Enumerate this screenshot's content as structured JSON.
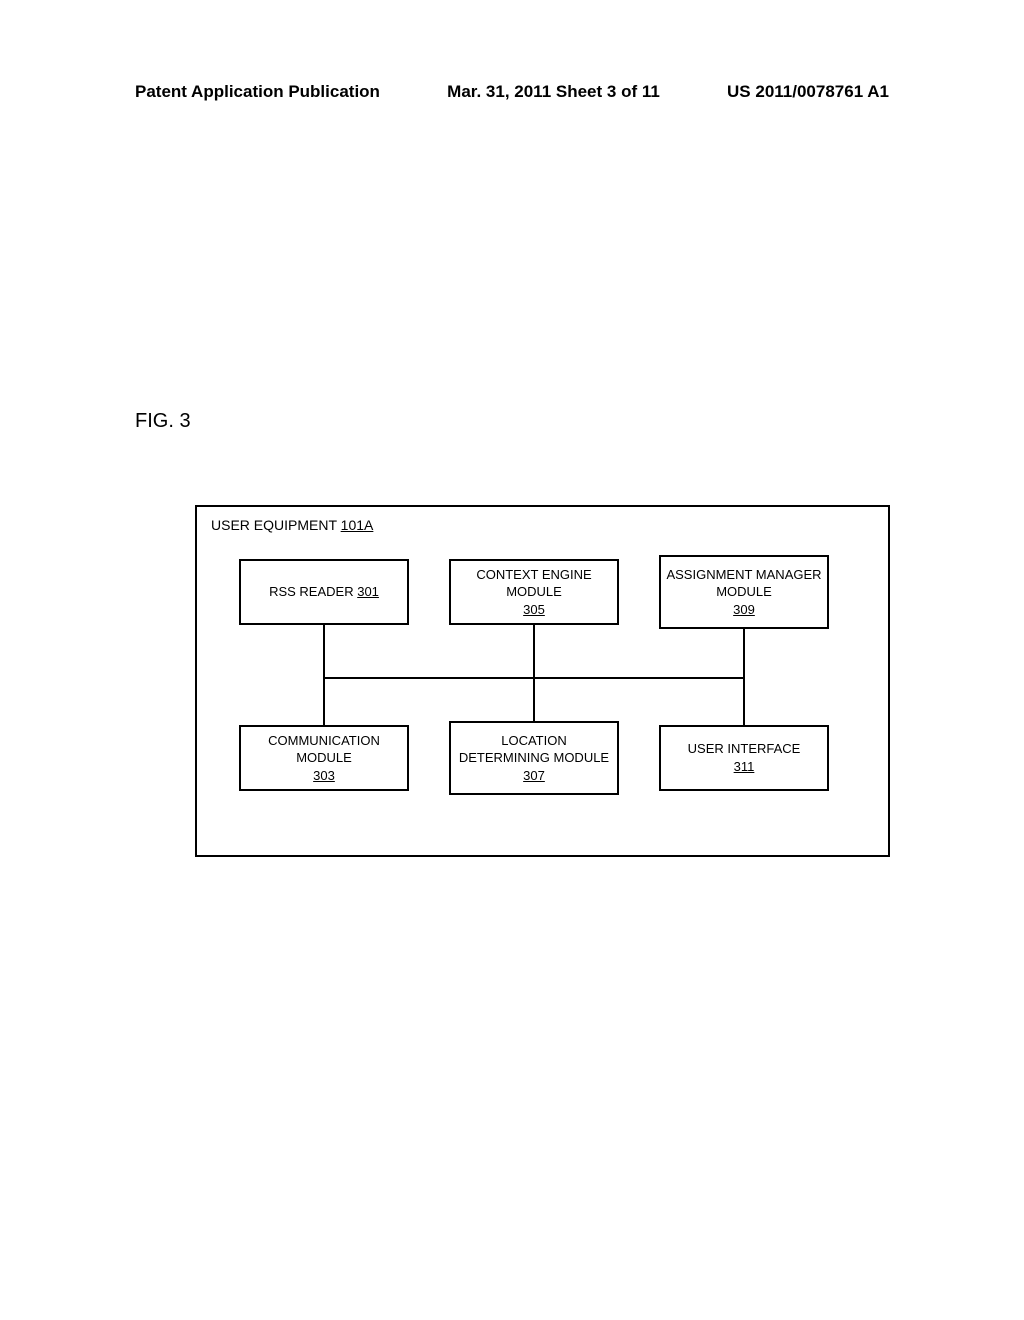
{
  "header": {
    "left": "Patent Application Publication",
    "center": "Mar. 31, 2011  Sheet 3 of 11",
    "right": "US 2011/0078761 A1"
  },
  "figure_label": "FIG. 3",
  "container": {
    "title": "USER EQUIPMENT",
    "ref": "101A"
  },
  "modules": {
    "top_left": {
      "label": "RSS READER",
      "ref": "301"
    },
    "top_center": {
      "label": "CONTEXT ENGINE MODULE",
      "ref": "305"
    },
    "top_right": {
      "label": "ASSIGNMENT MANAGER MODULE",
      "ref": "309"
    },
    "bot_left": {
      "label": "COMMUNICATION MODULE",
      "ref": "303"
    },
    "bot_center": {
      "label": "LOCATION DETERMINING MODULE",
      "ref": "307"
    },
    "bot_right": {
      "label": "USER INTERFACE",
      "ref": "311"
    }
  }
}
